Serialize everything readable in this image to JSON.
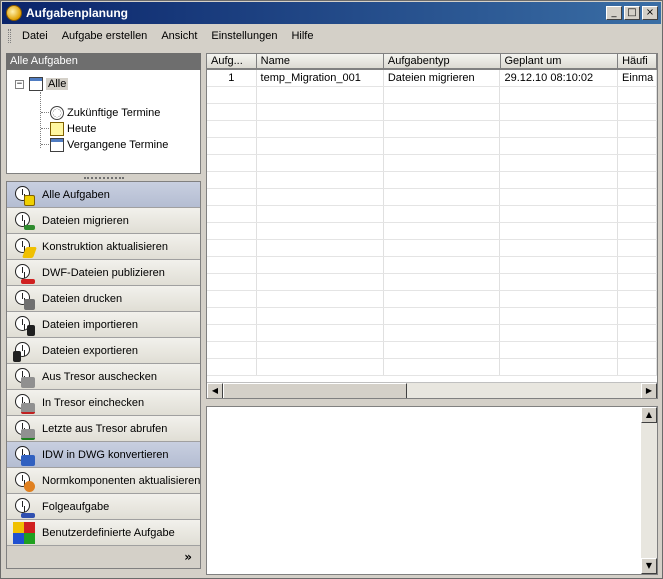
{
  "window": {
    "title": "Aufgabenplanung"
  },
  "titlebar_buttons": {
    "minimize": "_",
    "maximize": "□",
    "close": "×"
  },
  "menu": [
    {
      "label": "Datei"
    },
    {
      "label": "Aufgabe erstellen"
    },
    {
      "label": "Ansicht"
    },
    {
      "label": "Einstellungen"
    },
    {
      "label": "Hilfe"
    }
  ],
  "tree": {
    "header": "Alle Aufgaben",
    "root": {
      "label": "Alle",
      "expander": "−"
    },
    "children": [
      {
        "label": "Zukünftige Termine",
        "icon": "clock-icon"
      },
      {
        "label": "Heute",
        "icon": "star-calendar-icon"
      },
      {
        "label": "Vergangene Termine",
        "icon": "calendar-page-icon"
      }
    ]
  },
  "nav_items": [
    {
      "label": "Alle Aufgaben",
      "icon": "all-tasks-icon",
      "selected": true
    },
    {
      "label": "Dateien migrieren",
      "icon": "migrate-files-icon"
    },
    {
      "label": "Konstruktion aktualisieren",
      "icon": "update-design-icon"
    },
    {
      "label": "DWF-Dateien publizieren",
      "icon": "publish-dwf-icon"
    },
    {
      "label": "Dateien drucken",
      "icon": "print-files-icon"
    },
    {
      "label": "Dateien importieren",
      "icon": "import-files-icon"
    },
    {
      "label": "Dateien exportieren",
      "icon": "export-files-icon"
    },
    {
      "label": "Aus Tresor auschecken",
      "icon": "check-out-icon"
    },
    {
      "label": "In Tresor einchecken",
      "icon": "check-in-icon"
    },
    {
      "label": "Letzte aus Tresor abrufen",
      "icon": "get-latest-icon"
    },
    {
      "label": "IDW in DWG konvertieren",
      "icon": "convert-idw-icon",
      "hover": true
    },
    {
      "label": "Normkomponenten aktualisieren",
      "icon": "update-standard-parts-icon"
    },
    {
      "label": "Folgeaufgabe",
      "icon": "sequence-task-icon"
    },
    {
      "label": "Benutzerdefinierte Aufgabe",
      "icon": "custom-task-icon"
    }
  ],
  "nav_footer": "»",
  "grid": {
    "columns": [
      "Aufg...",
      "Name",
      "Aufgabentyp",
      "Geplant um",
      "Häufi"
    ],
    "rows": [
      [
        "1",
        "temp_Migration_001",
        "Dateien migrieren",
        "29.12.10 08:10:02",
        "Einma"
      ]
    ],
    "empty_rows": 17
  },
  "scroll": {
    "left": "◀",
    "right": "▶",
    "up": "▲",
    "down": "▼"
  }
}
